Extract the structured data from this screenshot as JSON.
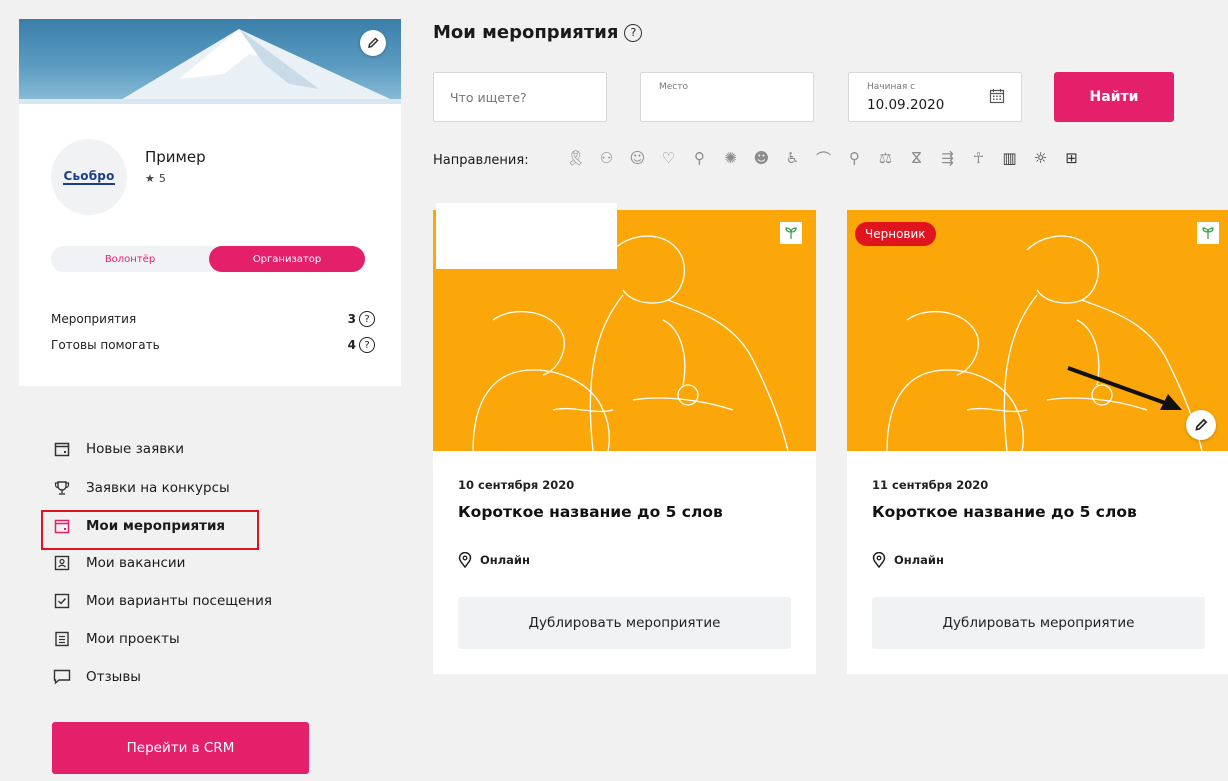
{
  "profile": {
    "name": "Пример",
    "rating": "5",
    "logo_text": "Сьобро",
    "roles": {
      "volunteer": "Волонтёр",
      "organizer": "Организатор"
    },
    "stats": [
      {
        "label": "Мероприятия",
        "value": "3"
      },
      {
        "label": "Готовы помогать",
        "value": "4"
      }
    ]
  },
  "menu": {
    "items": [
      {
        "label": "Новые заявки",
        "icon": "calendar-icon"
      },
      {
        "label": "Заявки на конкурсы",
        "icon": "trophy-icon"
      },
      {
        "label": "Мои мероприятия",
        "icon": "calendar-icon",
        "active": true
      },
      {
        "label": "Мои вакансии",
        "icon": "badge-icon"
      },
      {
        "label": "Мои варианты посещения",
        "icon": "checkbox-icon"
      },
      {
        "label": "Мои проекты",
        "icon": "document-icon"
      },
      {
        "label": "Отзывы",
        "icon": "comment-icon"
      }
    ],
    "crm_button": "Перейти в CRM"
  },
  "main": {
    "title": "Мои мероприятия",
    "help_symbol": "?",
    "search": {
      "query_placeholder": "Что ищете?",
      "place_label": "Место",
      "date_label": "Начиная с",
      "date_value": "10.09.2020",
      "submit": "Найти"
    },
    "directions_label": "Направления:"
  },
  "events": [
    {
      "date": "10 сентября 2020",
      "title": "Короткое название до 5 слов",
      "location": "Онлайн",
      "action": "Дублировать мероприятие"
    },
    {
      "badge": "Черновик",
      "date": "11 сентября 2020",
      "title": "Короткое название до 5 слов",
      "location": "Онлайн",
      "action": "Дублировать мероприятие"
    }
  ],
  "colors": {
    "accent": "#e4206b",
    "card_image": "#fba709",
    "draft": "#e0141e",
    "highlight_box": "#e0141e"
  }
}
